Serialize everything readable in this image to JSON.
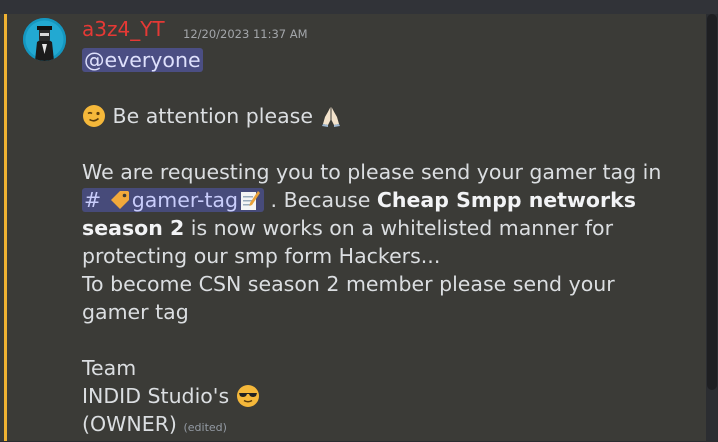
{
  "message": {
    "author": "a3z4_YT",
    "timestamp": "12/20/2023 11:37 AM",
    "mention": "@everyone",
    "line_attention": "Be attention please",
    "line_request": "We are requesting you to please send your gamer tag in",
    "channel_hash": "#",
    "channel_name": "gamer-tag",
    "because_text": " . Because ",
    "bold_text_1": "Cheap Smpp networks",
    "bold_text_2": "season 2",
    "line_whitelist": " is now works on a whitelisted manner for",
    "line_protect": "protecting our smp form Hackers...",
    "line_become": "To become CSN season 2 member please send your",
    "line_gamertag": "gamer tag",
    "line_team": "Team",
    "line_studio": "INDID Studio's",
    "line_owner": "(OWNER)",
    "edited_label": "(edited)"
  },
  "icons": {
    "avatar": "avatar",
    "wink": "winking-face-icon",
    "pray": "folded-hands-icon",
    "tag": "label-tag-icon",
    "memo": "memo-icon",
    "cool": "sunglasses-face-icon"
  }
}
